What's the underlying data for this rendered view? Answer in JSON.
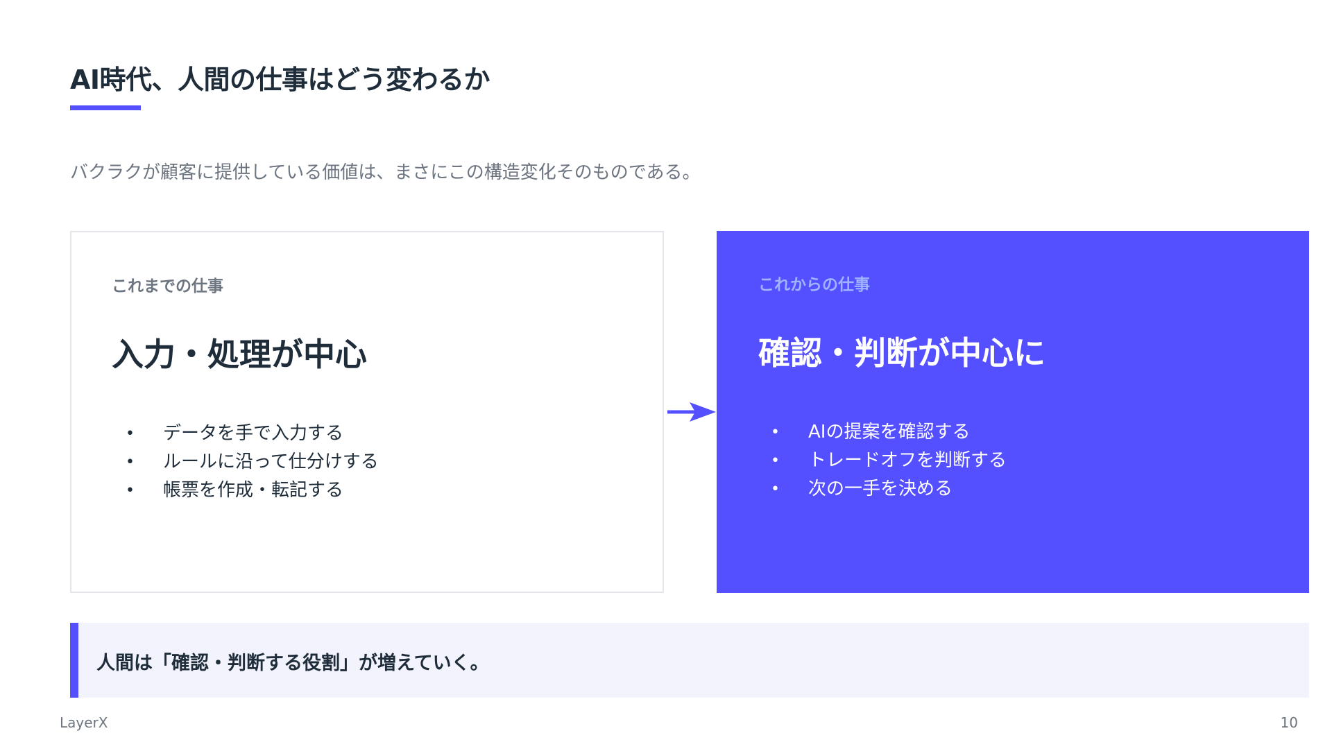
{
  "slide": {
    "title": "AI時代、人間の仕事はどう変わるか",
    "subtitle": "バクラクが顧客に提供している価値は、まさにこの構造変化そのものである。",
    "accent_color": "#5550ff"
  },
  "before": {
    "label": "これまでの仕事",
    "heading": "入力・処理が中心",
    "items": [
      "データを手で入力する",
      "ルールに沿って仕分けする",
      "帳票を作成・転記する"
    ]
  },
  "after": {
    "label": "これからの仕事",
    "heading": "確認・判断が中心に",
    "items": [
      "AIの提案を確認する",
      "トレードオフを判断する",
      "次の一手を決める"
    ]
  },
  "arrow_icon": "arrow-right-icon",
  "callout": {
    "text": "人間は「確認・判断する役割」が増えていく。"
  },
  "footer": {
    "brand": "LayerX",
    "page_number": "10"
  }
}
